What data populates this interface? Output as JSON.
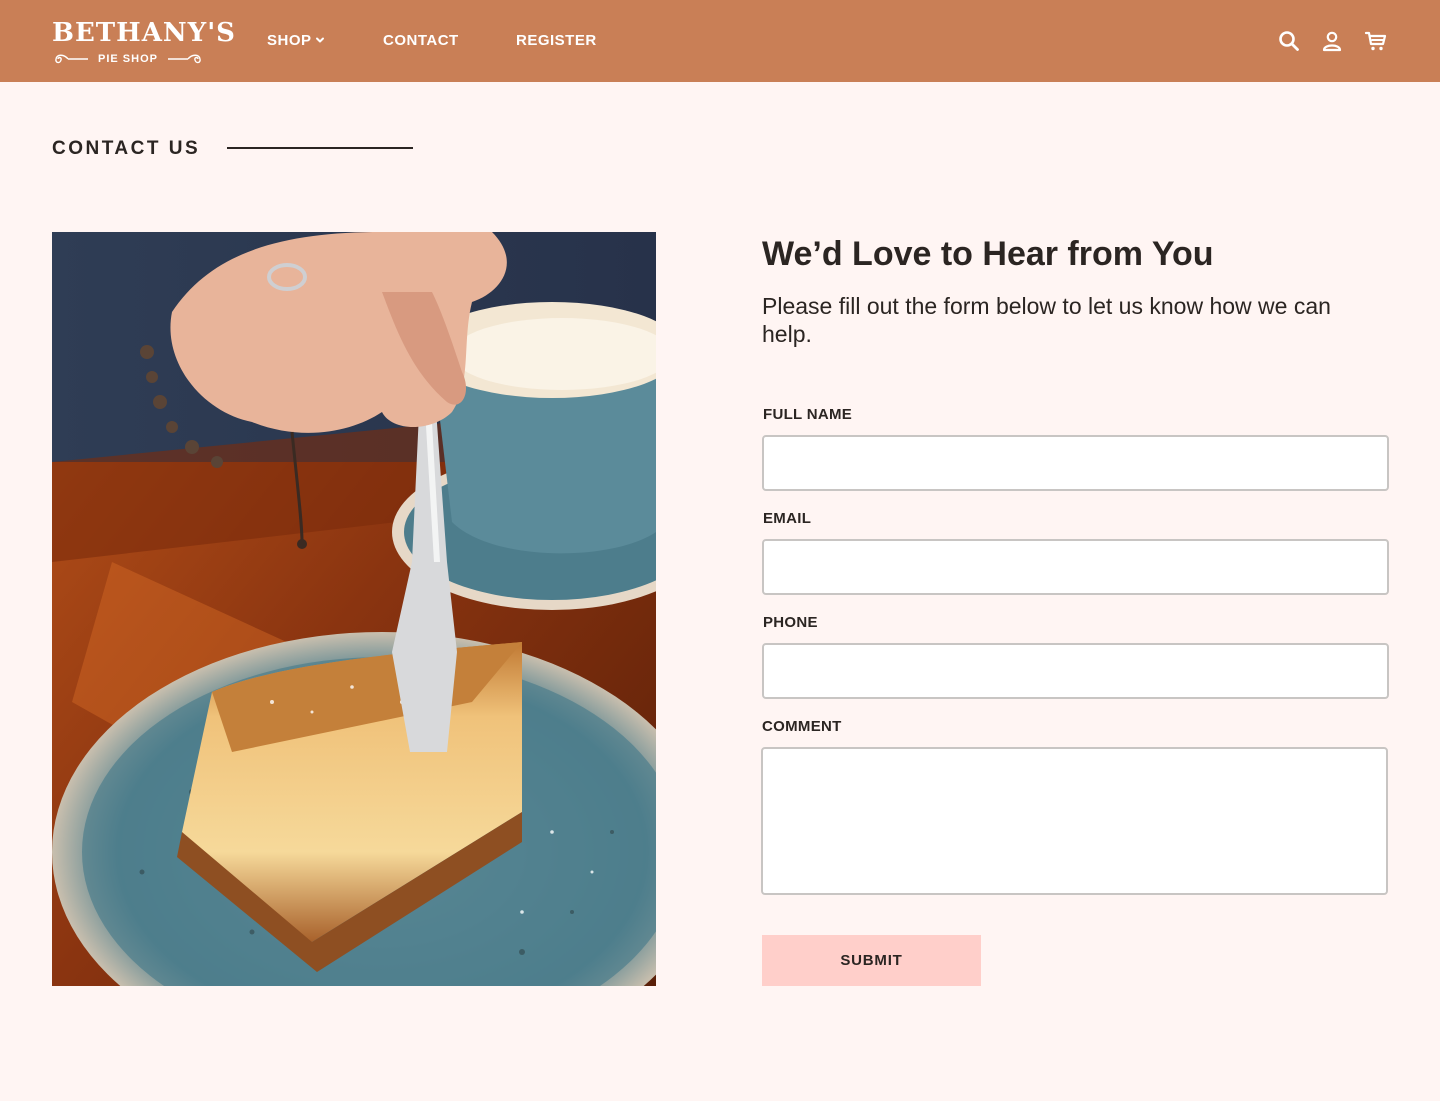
{
  "brand": {
    "name": "BETHANY'S",
    "tagline": "PIE SHOP"
  },
  "nav": {
    "shop_label": "SHOP",
    "contact_label": "CONTACT",
    "register_label": "REGISTER"
  },
  "header_icons": [
    "search-icon",
    "user-icon",
    "cart-icon"
  ],
  "section": {
    "title": "CONTACT US"
  },
  "contact": {
    "heading": "We’d Love to Hear from You",
    "intro": "Please fill out the form below to let us know how we can help.",
    "fields": {
      "full_name": {
        "label": "FULL NAME",
        "value": ""
      },
      "email": {
        "label": "EMAIL",
        "value": ""
      },
      "phone": {
        "label": "PHONE",
        "value": ""
      },
      "comment": {
        "label": "COMMENT",
        "value": ""
      }
    },
    "submit_label": "SUBMIT"
  },
  "colors": {
    "header_bg": "#c97f56",
    "page_bg": "#fff5f3",
    "submit_bg": "#ffcfca",
    "text": "#2b2522"
  }
}
